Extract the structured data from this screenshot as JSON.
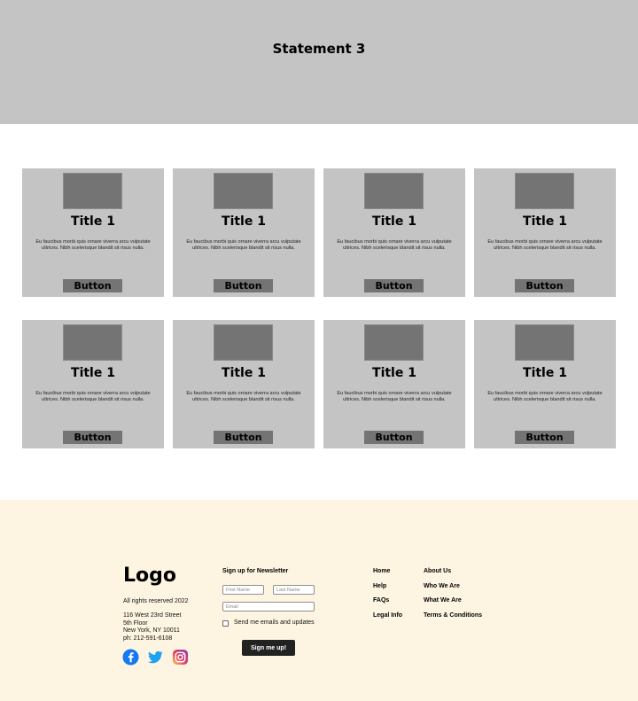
{
  "hero": {
    "title": "Statement 3"
  },
  "cards": [
    {
      "title": "Title 1",
      "text": "Eu faucibus morbi quis ornare viverra arcu vulputate ultrices. Nibh scelerisque blandit sit risus nulla.",
      "button": "Button"
    },
    {
      "title": "Title 1",
      "text": "Eu faucibus morbi quis ornare viverra arcu vulputate ultrices. Nibh scelerisque blandit sit risus nulla.",
      "button": "Button"
    },
    {
      "title": "Title 1",
      "text": "Eu faucibus morbi quis ornare viverra arcu vulputate ultrices. Nibh scelerisque blandit sit risus nulla.",
      "button": "Button"
    },
    {
      "title": "Title 1",
      "text": "Eu faucibus morbi quis ornare viverra arcu vulputate ultrices. Nibh scelerisque blandit sit risus nulla.",
      "button": "Button"
    },
    {
      "title": "Title 1",
      "text": "Eu faucibus morbi quis ornare viverra arcu vulputate ultrices. Nibh scelerisque blandit sit risus nulla.",
      "button": "Button"
    },
    {
      "title": "Title 1",
      "text": "Eu faucibus morbi quis ornare viverra arcu vulputate ultrices. Nibh scelerisque blandit sit risus nulla.",
      "button": "Button"
    },
    {
      "title": "Title 1",
      "text": "Eu faucibus morbi quis ornare viverra arcu vulputate ultrices. Nibh scelerisque blandit sit risus nulla.",
      "button": "Button"
    },
    {
      "title": "Title 1",
      "text": "Eu faucibus morbi quis ornare viverra arcu vulputate ultrices. Nibh scelerisque blandit sit risus nulla.",
      "button": "Button"
    }
  ],
  "footer": {
    "logo": "Logo",
    "rights": "All rights reserved 2022",
    "address": [
      "116 West 23rd Street",
      "5th Floor",
      "New York, NY 10011",
      "ph: 212-591-6108"
    ],
    "socials": [
      "facebook-icon",
      "twitter-icon",
      "instagram-icon"
    ],
    "newsletter": {
      "title": "Sign up for Newsletter",
      "first_name_placeholder": "First Name",
      "last_name_placeholder": "Last Name",
      "email_placeholder": "Email",
      "checkbox_label": "Send me emails and updates",
      "button": "Sign me up!"
    },
    "links_col1": [
      "Home",
      "Help",
      "FAQs",
      "Legal Info"
    ],
    "links_col2": [
      "About Us",
      "Who We Are",
      "What We Are",
      "Terms & Conditions"
    ]
  },
  "colors": {
    "hero_bg": "#c4c4c4",
    "card_bg": "#c4c4c4",
    "placeholder_gray": "#747474",
    "footer_bg": "#fdf5e1",
    "signup_button": "#222222",
    "facebook": "#1877f2",
    "twitter": "#1da1f2"
  }
}
